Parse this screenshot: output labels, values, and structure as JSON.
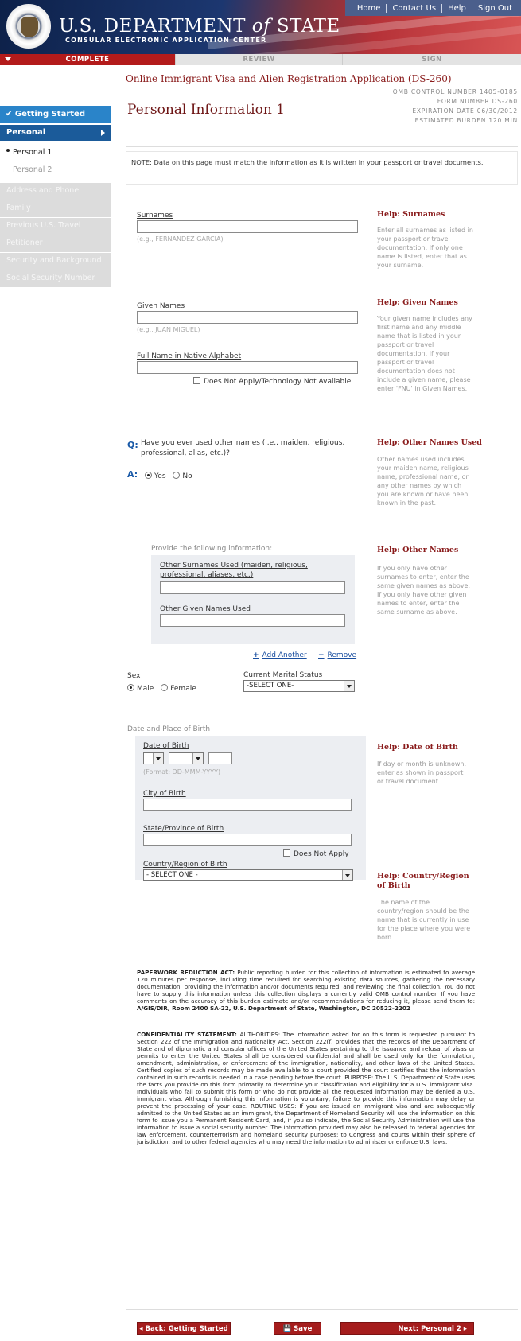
{
  "header": {
    "title_main": "U.S. DEPARTMENT of STATE",
    "title_main_pre": "U.S. DEPARTMENT ",
    "title_main_of": "of",
    "title_main_post": " STATE",
    "subtitle": "CONSULAR ELECTRONIC APPLICATION CENTER",
    "nav": [
      "Home",
      "Contact Us",
      "Help",
      "Sign Out"
    ]
  },
  "progress": {
    "steps": [
      "COMPLETE",
      "REVIEW",
      "SIGN"
    ],
    "current": 0
  },
  "app_title": "Online Immigrant Visa and Alien Registration Application (DS-260)",
  "omb": {
    "lines": [
      "OMB CONTROL NUMBER  1405-0185",
      "FORM NUMBER     DS-260",
      "EXPIRATION DATE  06/30/2012",
      "ESTIMATED BURDEN    120 MIN"
    ]
  },
  "page_title": "Personal Information 1",
  "sidebar": {
    "getting_started": "✔ Getting Started",
    "section": "Personal",
    "sub": [
      "Personal 1",
      "Personal 2"
    ],
    "disabled": [
      "Address and Phone",
      "Family",
      "Previous U.S. Travel",
      "Petitioner",
      "Security and Background",
      "Social Security Number"
    ]
  },
  "note": "NOTE: Data on this page must match the information as it is written in your passport or travel documents.",
  "form": {
    "surnames_label": "Surnames",
    "surnames_hint": "(e.g., FERNANDEZ GARCIA)",
    "given_label": "Given Names",
    "given_hint": "(e.g., JUAN MIGUEL)",
    "native_label": "Full Name in Native Alphabet",
    "native_dna": "Does Not Apply/Technology Not Available",
    "q": "Q:",
    "question": "Have you ever used other names (i.e., maiden, religious, professional, alias, etc.)?",
    "a": "A:",
    "yes": "Yes",
    "no": "No",
    "answer": "Yes",
    "provide": "Provide the following information:",
    "other_surnames_label": "Other Surnames Used (maiden, religious, professional, aliases, etc.)",
    "other_given_label": "Other Given Names Used",
    "add_another": "Add Another",
    "remove": "Remove",
    "sex_label": "Sex",
    "male": "Male",
    "female": "Female",
    "sex_value": "Male",
    "marital_label": "Current Marital Status",
    "marital_value": "-SELECT ONE-",
    "dpob_label": "Date and Place of Birth",
    "dob_label": "Date of Birth",
    "dob_hint": "(Format: DD-MMM-YYYY)",
    "city_label": "City of Birth",
    "state_label": "State/Province of Birth",
    "state_dna": "Does Not Apply",
    "country_label": "Country/Region of Birth",
    "country_value": "- SELECT ONE -"
  },
  "help": [
    {
      "title_pre": "Help: ",
      "title": "Surnames",
      "body": "Enter all surnames as listed in your passport or travel documentation. If only one name is listed, enter that as your surname."
    },
    {
      "title_pre": "Help: ",
      "title": "Given Names",
      "body": "Your given name includes any first name and any middle name that is listed in your passport or travel documentation. If your passport or travel documentation does not include a given name, please enter 'FNU' in Given Names."
    },
    {
      "title_pre": "Help: ",
      "title": "Other Names Used",
      "body": "Other names used includes your maiden name, religious name, professional name, or any other names by which you are known or have been known in the past."
    },
    {
      "title_pre": "Help: ",
      "title": "Other Names",
      "body": "If you only have other surnames to enter, enter the same given names as above. If you only have other given names to enter, enter the same surname as above."
    },
    {
      "title_pre": "Help: ",
      "title": "Date of Birth",
      "body": "If day or month is unknown, enter as shown in passport or travel document."
    },
    {
      "title_pre": "Help: ",
      "title": "Country/Region of Birth",
      "body": "The name of the country/region should be the name that is currently in use for the place where you were born."
    }
  ],
  "legal": {
    "paperwork_head": "PAPERWORK REDUCTION ACT:",
    "paperwork": " Public reporting burden for this collection of information is estimated to average 120 minutes per response, including time required for searching existing data sources, gathering the necessary documentation, providing the information and/or documents required, and reviewing the final collection. You do not have to supply this information unless this collection displays a currently valid OMB control number. If you have comments on the accuracy of this burden estimate and/or recommendations for reducing it, please send them to: ",
    "paperwork_addr": "A/GIS/DIR, Room 2400 SA-22, U.S. Department of State, Washington, DC 20522-2202",
    "conf_head": "CONFIDENTIALITY STATEMENT:",
    "conf": " AUTHORITIES: The information asked for on this form is requested pursuant to Section 222 of the Immigration and Nationality Act. Section 222(f) provides that the records of the Department of State and of diplomatic and consular offices of the United States pertaining to the issuance and refusal of visas or permits to enter the United States shall be considered confidential and shall be used only for the formulation, amendment, administration, or enforcement of the immigration, nationality, and other laws of the United States. Certified copies of such records may be made available to a court provided the court certifies that the information contained in such records is needed in a case pending before the court. PURPOSE: The U.S. Department of State uses the facts you provide on this form primarily to determine your classification and eligibility for a U.S. immigrant visa. Individuals who fail to submit this form or who do not provide all the requested information may be denied a U.S. immigrant visa. Although furnishing this information is voluntary, failure to provide this information may delay or prevent the processing of your case. ROUTINE USES: If you are issued an immigrant visa and are subsequently admitted to the United States as an immigrant, the Department of Homeland Security will use the information on this form to issue you a Permanent Resident Card, and, if you so indicate, the Social Security Administration will use the information to issue a social security number. The information provided may also be released to federal agencies for law enforcement, counterterrorism and homeland security purposes; to Congress and courts within their sphere of jurisdiction; and to other federal agencies who may need the information to administer or enforce U.S. laws."
  },
  "buttons": {
    "back": "◂ Back: Getting Started",
    "save": "💾 Save",
    "next": "Next: Personal 2 ▸"
  }
}
